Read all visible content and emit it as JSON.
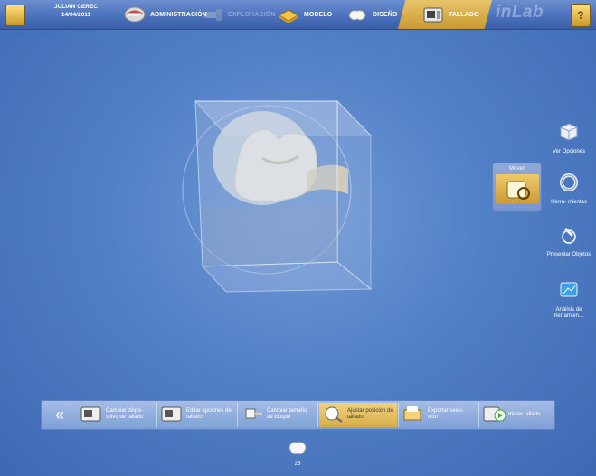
{
  "header": {
    "patient_name": "JULIAN CEREC",
    "patient_date": "14/04/2011",
    "tabs": [
      {
        "label": "ADMINISTRACIÓN"
      },
      {
        "label": "EXPLORACIÓN"
      },
      {
        "label": "MODELO"
      },
      {
        "label": "DISEÑO"
      },
      {
        "label": "TALLADO"
      }
    ],
    "brand": "inLab",
    "help_glyph": "?"
  },
  "side_tools": [
    {
      "label": "Ver Opciones",
      "icon": "view-cube-icon"
    },
    {
      "label": "Herra- mientas",
      "icon": "tools-ring-icon"
    },
    {
      "label": "Presentar Objetos",
      "icon": "present-objects-icon"
    },
    {
      "label": "Análisis de herramien...",
      "icon": "tool-analysis-icon"
    }
  ],
  "mover": {
    "label": "Mover"
  },
  "steps": [
    {
      "label": "Cambiar dispo- sitivo de tallado",
      "active": false
    },
    {
      "label": "Editar opciones de tallado",
      "active": false
    },
    {
      "label": "Cambiar tamaño de bloque",
      "active": false
    },
    {
      "label": "Ajustar posición de tallado",
      "active": true
    },
    {
      "label": "Exportar selec- ción",
      "active": false
    },
    {
      "label": "Iniciar tallado",
      "active": false
    }
  ],
  "back_glyph": "«",
  "tooth_number": "25",
  "colors": {
    "accent_gold": "#d7ad4a",
    "progress_green": "#6ed15a",
    "background_blue": "#5280c6"
  }
}
